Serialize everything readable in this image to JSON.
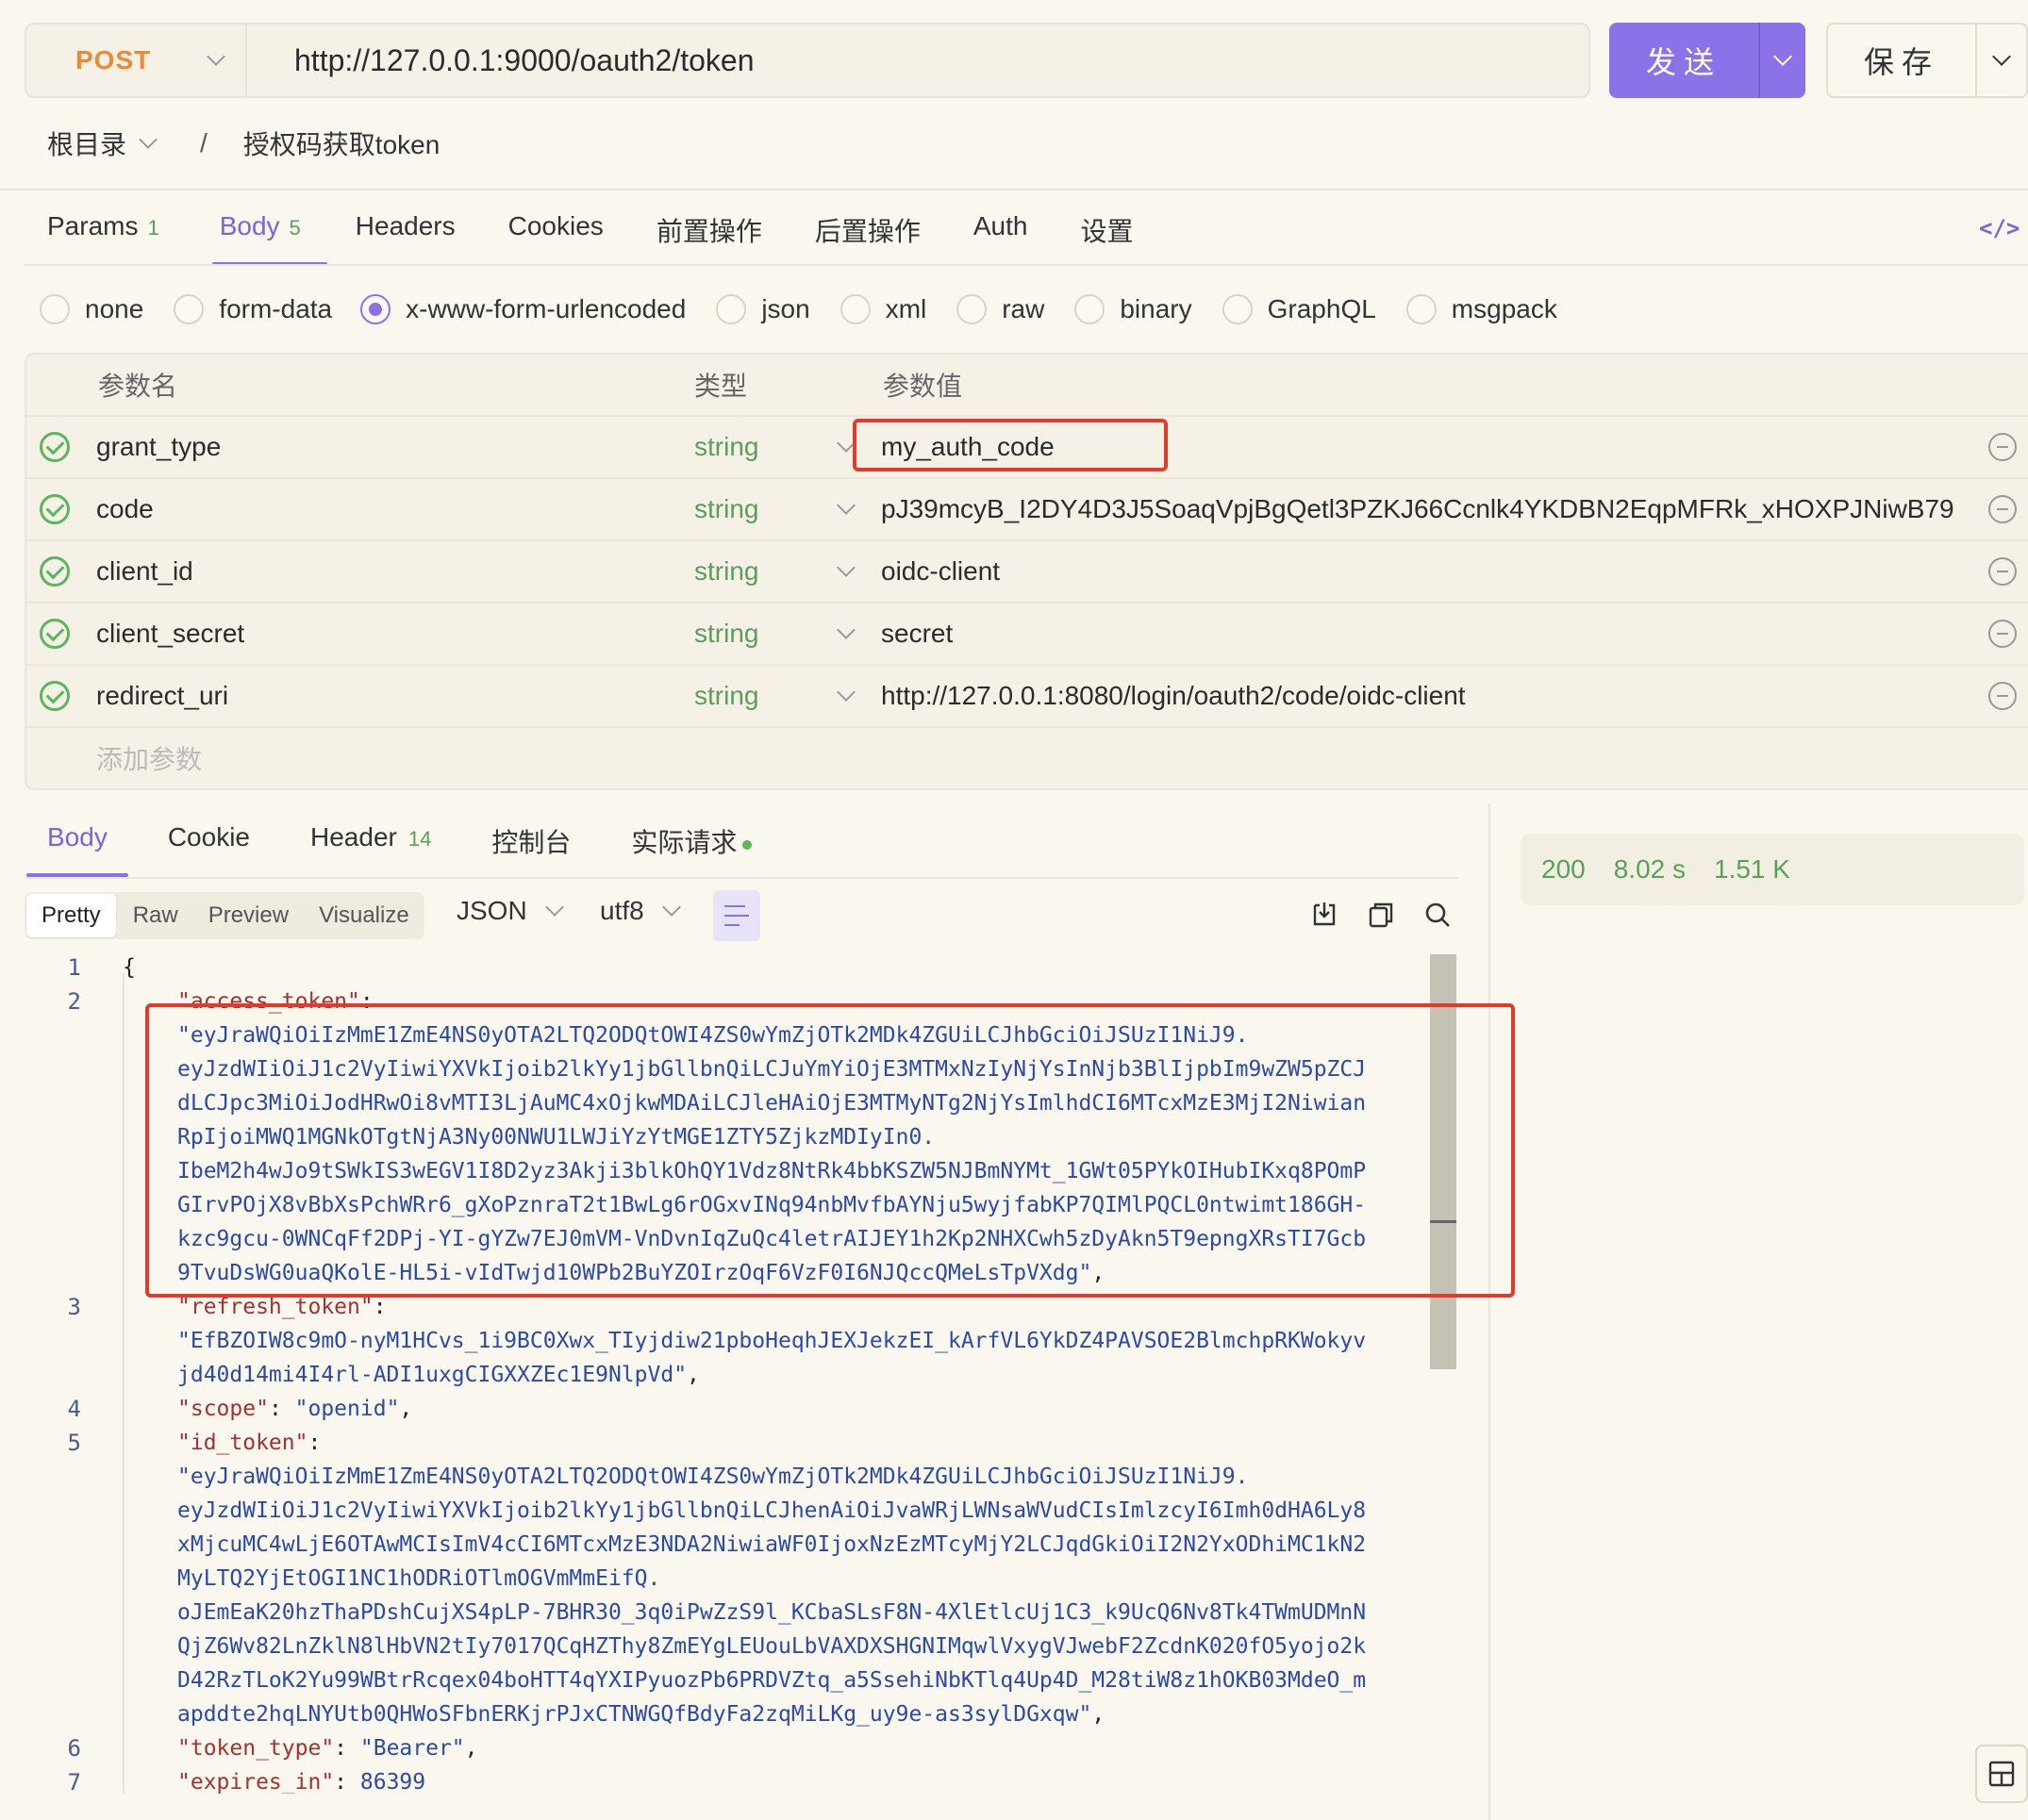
{
  "request": {
    "method": "POST",
    "url": "http://127.0.0.1:9000/oauth2/token",
    "send_label": "发送",
    "save_label": "保存"
  },
  "breadcrumb": {
    "root": "根目录",
    "separator": "/",
    "current": "授权码获取token"
  },
  "request_tabs": [
    {
      "label": "Params",
      "badge": "1"
    },
    {
      "label": "Body",
      "badge": "5"
    },
    {
      "label": "Headers",
      "badge": ""
    },
    {
      "label": "Cookies",
      "badge": ""
    },
    {
      "label": "前置操作",
      "badge": ""
    },
    {
      "label": "后置操作",
      "badge": ""
    },
    {
      "label": "Auth",
      "badge": ""
    },
    {
      "label": "设置",
      "badge": ""
    }
  ],
  "body_types": [
    "none",
    "form-data",
    "x-www-form-urlencoded",
    "json",
    "xml",
    "raw",
    "binary",
    "GraphQL",
    "msgpack"
  ],
  "body_type_selected": "x-www-form-urlencoded",
  "params_table": {
    "headers": {
      "name": "参数名",
      "type": "类型",
      "value": "参数值"
    },
    "rows": [
      {
        "name": "grant_type",
        "type": "string",
        "value": "my_auth_code"
      },
      {
        "name": "code",
        "type": "string",
        "value": "pJ39mcyB_I2DY4D3J5SoaqVpjBgQetl3PZKJ66Ccnlk4YKDBN2EqpMFRk_xHOXPJNiwB79"
      },
      {
        "name": "client_id",
        "type": "string",
        "value": "oidc-client"
      },
      {
        "name": "client_secret",
        "type": "string",
        "value": "secret"
      },
      {
        "name": "redirect_uri",
        "type": "string",
        "value": "http://127.0.0.1:8080/login/oauth2/code/oidc-client"
      }
    ],
    "add_placeholder": "添加参数"
  },
  "response_tabs": [
    {
      "label": "Body",
      "badge": ""
    },
    {
      "label": "Cookie",
      "badge": ""
    },
    {
      "label": "Header",
      "badge": "14"
    },
    {
      "label": "控制台",
      "badge": ""
    },
    {
      "label": "实际请求",
      "badge": ""
    }
  ],
  "response_status": {
    "code": "200",
    "time": "8.02 s",
    "size": "1.51 K"
  },
  "response_view_modes": [
    "Pretty",
    "Raw",
    "Preview",
    "Visualize"
  ],
  "response_format": "JSON",
  "response_encoding": "utf8",
  "code_lines": [
    {
      "ln": "1",
      "brace": "{"
    },
    {
      "ln": "2",
      "key": "\"access_token\"",
      "pun": ":"
    },
    {
      "str": "\"eyJraWQiOiIzMmE1ZmE4NS0yOTA2LTQ2ODQtOWI4ZS0wYmZjOTk2MDk4ZGUiLCJhbGciOiJSUzI1NiJ9."
    },
    {
      "str": "eyJzdWIiOiJ1c2VyIiwiYXVkIjoib2lkYy1jbGllbnQiLCJuYmYiOjE3MTMxNzIyNjYsInNjb3BlIjpbIm9wZW5pZCJ"
    },
    {
      "str": "dLCJpc3MiOiJodHRwOi8vMTI3LjAuMC4xOjkwMDAiLCJleHAiOjE3MTMyNTg2NjYsImlhdCI6MTcxMzE3MjI2Niwian"
    },
    {
      "str": "RpIjoiMWQ1MGNkOTgtNjA3Ny00NWU1LWJiYzYtMGE1ZTY5ZjkzMDIyIn0."
    },
    {
      "str": "IbeM2h4wJo9tSWkIS3wEGV1I8D2yz3Akji3blkOhQY1Vdz8NtRk4bbKSZW5NJBmNYMt_1GWt05PYkOIHubIKxq8POmP"
    },
    {
      "str": "GIrvPOjX8vBbXsPchWRr6_gXoPznraT2t1BwLg6rOGxvINq94nbMvfbAYNju5wyjfabKP7QIMlPQCL0ntwimt186GH-"
    },
    {
      "str": "kzc9gcu-0WNCqFf2DPj-YI-gYZw7EJ0mVM-VnDvnIqZuQc4letrAIJEY1h2Kp2NHXCwh5zDyAkn5T9epngXRsTI7Gcb"
    },
    {
      "str": "9TvuDsWG0uaQKolE-HL5i-vIdTwjd10WPb2BuYZOIrzOqF6VzF0I6NJQccQMeLsTpVXdg\"",
      "pun": ","
    },
    {
      "ln": "3",
      "key": "\"refresh_token\"",
      "pun": ":"
    },
    {
      "str": "\"EfBZOIW8c9mO-nyM1HCvs_1i9BC0Xwx_TIyjdiw21pboHeqhJEXJekzEI_kArfVL6YkDZ4PAVSOE2BlmchpRKWokyv"
    },
    {
      "str": "jd40d14mi4I4rl-ADI1uxgCIGXXZEc1E9NlpVd\"",
      "pun": ","
    },
    {
      "ln": "4",
      "key": "\"scope\"",
      "pun": ": ",
      "str2": "\"openid\"",
      "pun2": ","
    },
    {
      "ln": "5",
      "key": "\"id_token\"",
      "pun": ":"
    },
    {
      "str": "\"eyJraWQiOiIzMmE1ZmE4NS0yOTA2LTQ2ODQtOWI4ZS0wYmZjOTk2MDk4ZGUiLCJhbGciOiJSUzI1NiJ9."
    },
    {
      "str": "eyJzdWIiOiJ1c2VyIiwiYXVkIjoib2lkYy1jbGllbnQiLCJhenAiOiJvaWRjLWNsaWVudCIsImlzcyI6Imh0dHA6Ly8"
    },
    {
      "str": "xMjcuMC4wLjE6OTAwMCIsImV4cCI6MTcxMzE3NDA2NiwiaWF0IjoxNzEzMTcyMjY2LCJqdGkiOiI2N2YxODhiMC1kN2"
    },
    {
      "str": "MyLTQ2YjEtOGI1NC1hODRiOTlmOGVmMmEifQ."
    },
    {
      "str": "oJEmEaK20hzThaPDshCujXS4pLP-7BHR30_3q0iPwZzS9l_KCbaSLsF8N-4XlEtlcUj1C3_k9UcQ6Nv8Tk4TWmUDMnN"
    },
    {
      "str": "QjZ6Wv82LnZklN8lHbVN2tIy7017QCqHZThy8ZmEYgLEUouLbVAXDXSHGNIMqwlVxygVJwebF2ZcdnK020fO5yojo2k"
    },
    {
      "str": "D42RzTLoK2Yu99WBtrRcqex04boHTT4qYXIPyuozPb6PRDVZtq_a5SsehiNbKTlq4Up4D_M28tiW8z1hOKB03MdeO_m"
    },
    {
      "str": "apddte2hqLNYUtb0QHWoSFbnERKjrPJxCTNWGQfBdyFa2zqMiLKg_uy9e-as3sylDGxqw\"",
      "pun": ","
    },
    {
      "ln": "6",
      "key": "\"token_type\"",
      "pun": ": ",
      "str2": "\"Bearer\"",
      "pun2": ","
    },
    {
      "ln": "7",
      "key": "\"expires_in\"",
      "pun": ": ",
      "num": "86399"
    }
  ],
  "colors": {
    "accent": "#8c72e8",
    "method": "#ec8a33",
    "ok": "#56a356",
    "highlight": "#e23b2c"
  }
}
